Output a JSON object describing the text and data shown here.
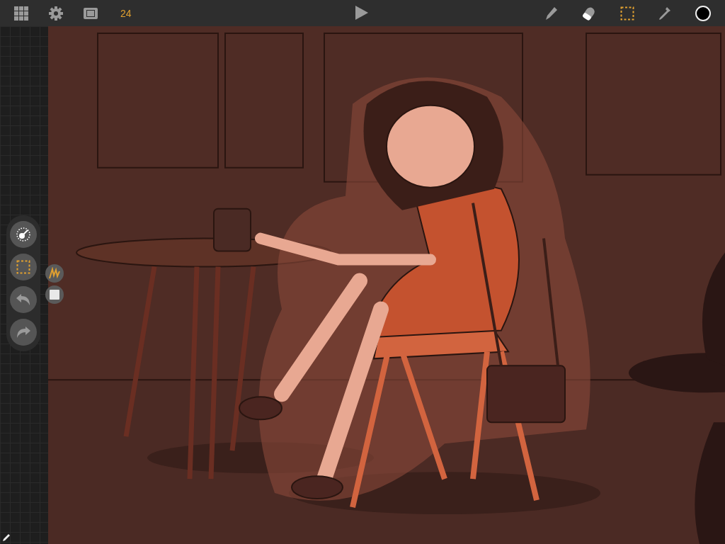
{
  "toolbar": {
    "frame_rate": "24",
    "tools": [
      {
        "kind": "pencil",
        "selected": false
      },
      {
        "kind": "eraser",
        "selected": false
      },
      {
        "kind": "select",
        "selected": true
      },
      {
        "kind": "eyedropper",
        "selected": false
      }
    ]
  },
  "side_tools": [
    {
      "kind": "transform",
      "selected": false
    },
    {
      "kind": "select",
      "selected": true
    },
    {
      "kind": "undo",
      "selected": false
    },
    {
      "kind": "redo",
      "selected": false
    }
  ],
  "select_modes": [
    {
      "kind": "lasso",
      "selected": true
    },
    {
      "kind": "rect",
      "selected": false
    }
  ]
}
